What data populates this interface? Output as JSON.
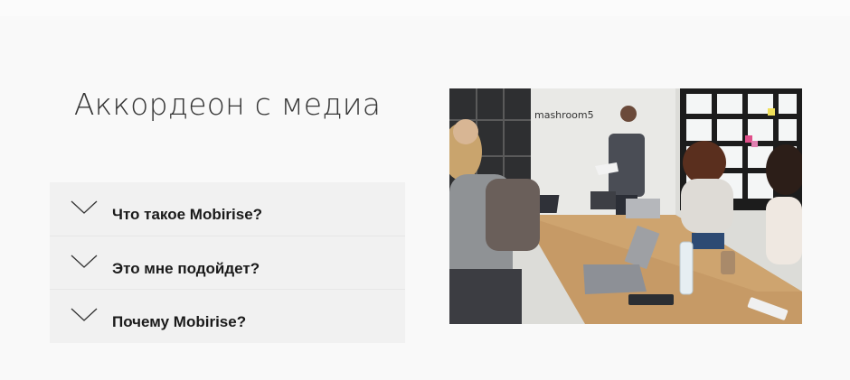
{
  "section": {
    "title": "Аккордеон с медиа"
  },
  "accordion": {
    "items": [
      {
        "label": "Что такое Mobirise?",
        "icon": "chevron-down-icon"
      },
      {
        "label": "Это мне подойдет?",
        "icon": "chevron-down-icon"
      },
      {
        "label": "Почему Mobirise?",
        "icon": "chevron-down-icon"
      }
    ]
  },
  "media": {
    "wall_text": "mashroom5"
  }
}
